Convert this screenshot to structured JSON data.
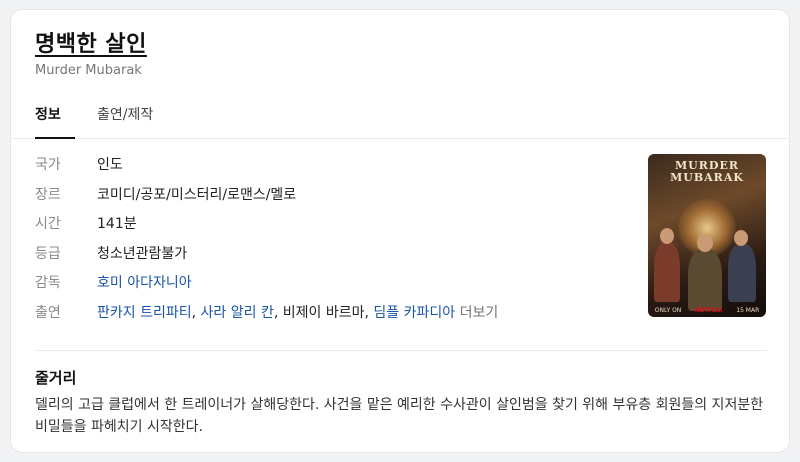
{
  "title": "명백한 살인",
  "subtitle": "Murder Mubarak",
  "tabs": [
    {
      "label": "정보",
      "active": true
    },
    {
      "label": "출연/제작",
      "active": false
    }
  ],
  "info": {
    "country": {
      "label": "국가",
      "value": "인도"
    },
    "genre": {
      "label": "장르",
      "value": "코미디/공포/미스터리/로맨스/멜로"
    },
    "runtime": {
      "label": "시간",
      "value": "141분"
    },
    "rating": {
      "label": "등급",
      "value": "청소년관람불가"
    },
    "director": {
      "label": "감독",
      "name": "호미 아다자니아"
    },
    "cast": {
      "label": "출연",
      "items": [
        {
          "name": "판카지 트리파티",
          "linked": true,
          "sep": ", "
        },
        {
          "name": "사라 알리 칸",
          "linked": true,
          "sep": ", "
        },
        {
          "name": "비제이 바르마",
          "linked": false,
          "sep": ", "
        },
        {
          "name": "딤플 카파디아",
          "linked": true,
          "sep": ""
        }
      ],
      "more": "더보기"
    }
  },
  "poster": {
    "title_line1": "MURDER",
    "title_line2": "MUBARAK",
    "footer_left": "ONLY ON",
    "footer_brand": "NETFLIX",
    "footer_right": "15 MAR"
  },
  "synopsis": {
    "heading": "줄거리",
    "text": "델리의 고급 클럽에서 한 트레이너가 살해당한다. 사건을 맡은 예리한 수사관이 살인범을 찾기 위해 부유층 회원들의 지저분한 비밀들을 파헤치기 시작한다."
  },
  "colors": {
    "link": "#1a55a8",
    "label": "#8a8a8a",
    "title": "#111111"
  }
}
